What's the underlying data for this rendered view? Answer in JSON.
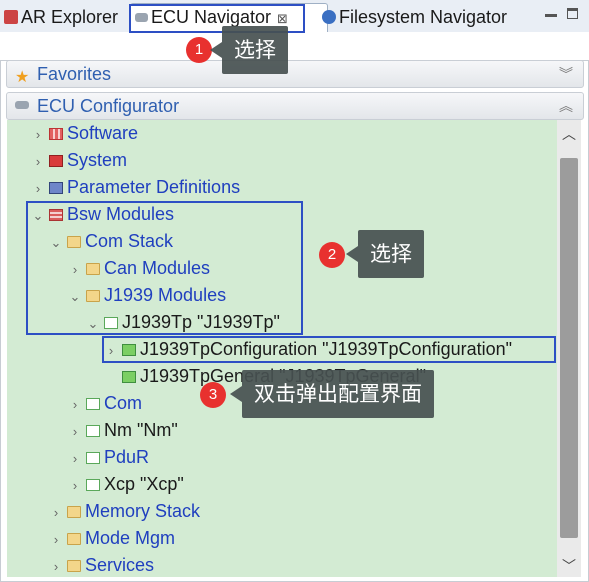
{
  "tabs": [
    {
      "label": "AR Explorer"
    },
    {
      "label": "ECU Navigator",
      "close": "⊠"
    },
    {
      "label": "Filesystem Navigator"
    }
  ],
  "sections": {
    "favorites": "Favorites",
    "ecu_configurator": "ECU Configurator"
  },
  "tree": [
    {
      "label": "Software",
      "arrow": "›"
    },
    {
      "label": "System",
      "arrow": "›"
    },
    {
      "label": "Parameter Definitions",
      "arrow": "›"
    },
    {
      "label": "Bsw Modules",
      "arrow": "⌄"
    },
    {
      "label": "Com Stack",
      "arrow": "⌄"
    },
    {
      "label": "Can Modules",
      "arrow": "›"
    },
    {
      "label": "J1939 Modules",
      "arrow": "⌄"
    },
    {
      "label": "J1939Tp \"J1939Tp\"",
      "arrow": "⌄"
    },
    {
      "label": "J1939TpConfiguration \"J1939TpConfiguration\"",
      "arrow": "›"
    },
    {
      "label": "J1939TpGeneral \"J1939TpGeneral\"",
      "arrow": ""
    },
    {
      "label": "Com",
      "arrow": "›"
    },
    {
      "label": "Nm \"Nm\"",
      "arrow": "›"
    },
    {
      "label": "PduR",
      "arrow": "›"
    },
    {
      "label": "Xcp \"Xcp\"",
      "arrow": "›"
    },
    {
      "label": "Memory Stack",
      "arrow": "›"
    },
    {
      "label": "Mode Mgm",
      "arrow": "›"
    },
    {
      "label": "Services",
      "arrow": "›"
    }
  ],
  "annotations": [
    {
      "number": "1",
      "text": "选择"
    },
    {
      "number": "2",
      "text": "选择"
    },
    {
      "number": "3",
      "text": "双击弹出配置界面"
    }
  ],
  "colors": {
    "tree_background": "#d3ebd3",
    "highlight_border": "#2d4fc4",
    "badge": "#e8312f",
    "callout": "#465050"
  }
}
